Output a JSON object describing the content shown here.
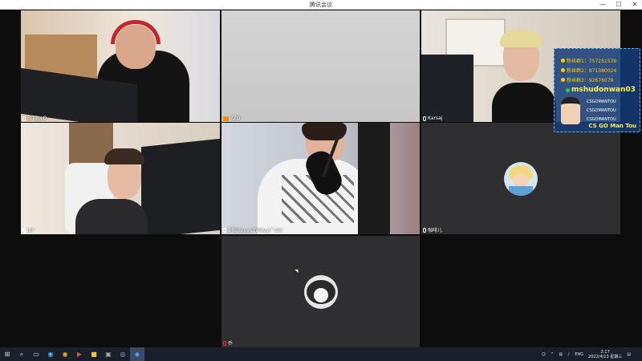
{
  "window": {
    "title": "腾讯会议",
    "controls": [
      "—",
      "☐",
      "✕"
    ]
  },
  "participants": [
    {
      "name": "BridgeO",
      "video": true,
      "host": false
    },
    {
      "name": "YZG",
      "video": true,
      "host": true
    },
    {
      "name": "Karsaj",
      "video": true,
      "host": false
    },
    {
      "name": "lxf",
      "video": true,
      "host": false
    },
    {
      "name": "刘皓douyuTVdiyy(^ah)",
      "video": true,
      "host": false
    },
    {
      "name": "咖啡儿",
      "video": false,
      "host": false
    },
    {
      "name": "乔",
      "video": false,
      "host": false
    }
  ],
  "overlay": {
    "lines": [
      {
        "text": "粉丝群1：757251539",
        "icon": "yellow"
      },
      {
        "text": "粉丝群2：871380024",
        "icon": "yellow"
      },
      {
        "text": "粉丝群3：92676079",
        "icon": "yellow"
      }
    ],
    "handle": "mshudonwan03",
    "small_lines": [
      "CSGOMANTOU",
      "CSGOMANTOU",
      "CSGOMANTOU"
    ],
    "footer": "CS GO Man Tou"
  },
  "taskbar": {
    "icons": [
      "windows-start-icon",
      "search-icon",
      "task-view-icon",
      "edge-browser-icon",
      "chrome-icon",
      "media-icon",
      "folder-icon",
      "app-icon",
      "steam-icon",
      "tencent-meeting-icon"
    ],
    "lang": "ENG",
    "time": "2:17",
    "date": "2022/4/13 星期三"
  }
}
